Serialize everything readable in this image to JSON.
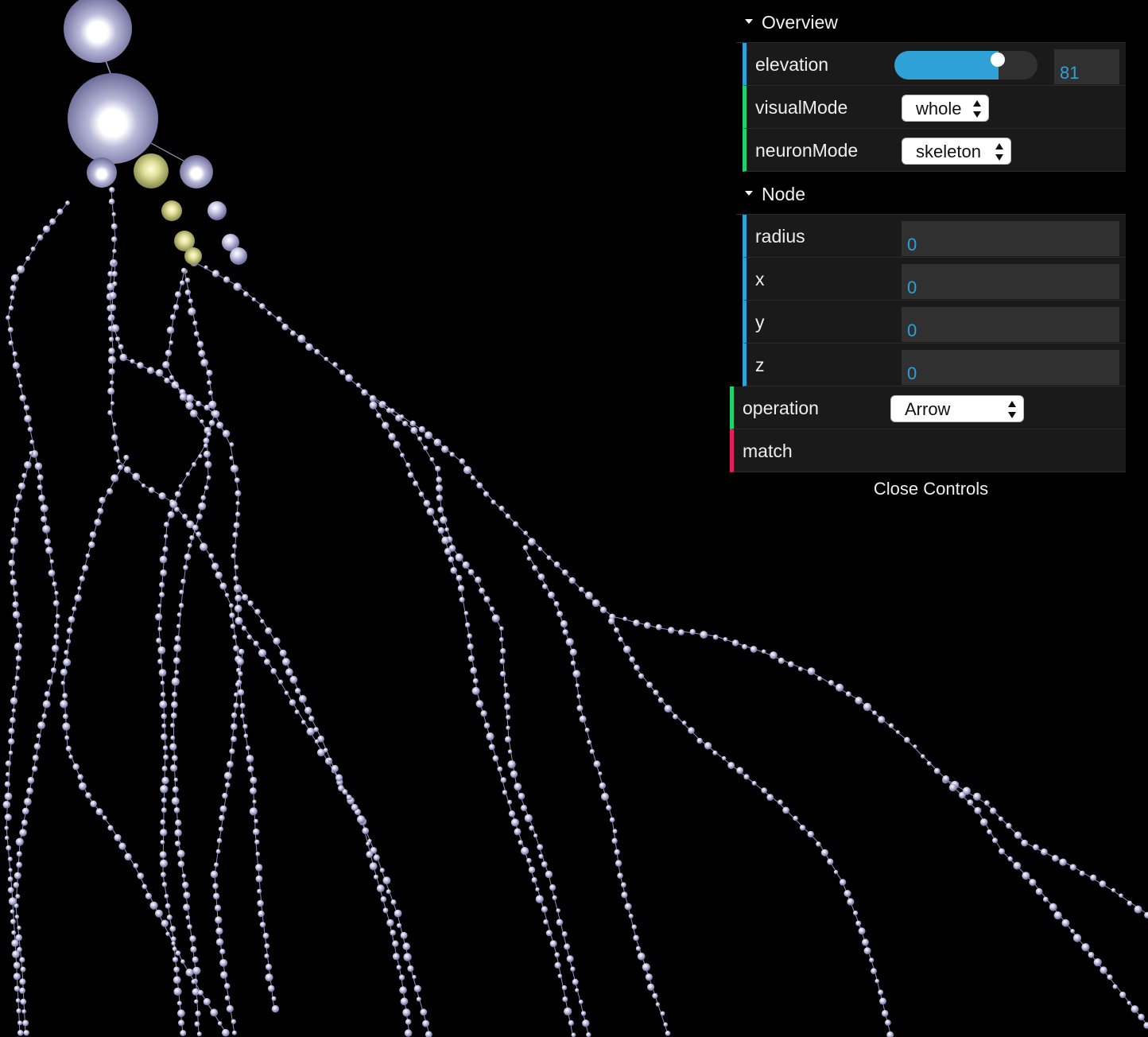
{
  "gui": {
    "folders": {
      "overview": "Overview",
      "node": "Node"
    },
    "elevation": {
      "label": "elevation",
      "value": "81",
      "fill_fraction": 0.73
    },
    "visualMode": {
      "label": "visualMode",
      "selected": "whole"
    },
    "neuronMode": {
      "label": "neuronMode",
      "selected": "skeleton"
    },
    "radius": {
      "label": "radius",
      "value": "0"
    },
    "x": {
      "label": "x",
      "value": "0"
    },
    "y": {
      "label": "y",
      "value": "0"
    },
    "z": {
      "label": "z",
      "value": "0"
    },
    "operation": {
      "label": "operation",
      "selected": "Arrow"
    },
    "match": {
      "label": "match"
    },
    "close_label": "Close Controls"
  },
  "colors": {
    "background": "#000000",
    "number_accent": "#2fa1d6",
    "function_accent": "#e61d5f",
    "option_accent": "#1ed36f",
    "neuron_node": "#b9b9dc",
    "highlight_node": "#e7e79a"
  }
}
